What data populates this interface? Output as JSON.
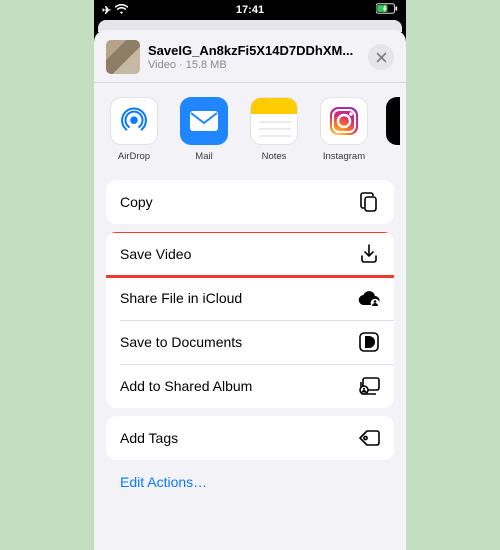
{
  "status": {
    "time": "17:41",
    "airplane": "✈",
    "wifi": "wifi",
    "battery": "battery-charging"
  },
  "file": {
    "name": "SaveIG_An8kzFi5X14D7DDhXM...",
    "kind": "Video",
    "size": "15.8 MB"
  },
  "share_apps": [
    {
      "id": "airdrop",
      "label": "AirDrop"
    },
    {
      "id": "mail",
      "label": "Mail"
    },
    {
      "id": "notes",
      "label": "Notes"
    },
    {
      "id": "instagram",
      "label": "Instagram"
    }
  ],
  "actions": {
    "copy": "Copy",
    "save_video": "Save Video",
    "icloud": "Share File in iCloud",
    "documents": "Save to Documents",
    "shared_album": "Add to Shared Album",
    "add_tags": "Add Tags"
  },
  "edit_actions": "Edit Actions…"
}
